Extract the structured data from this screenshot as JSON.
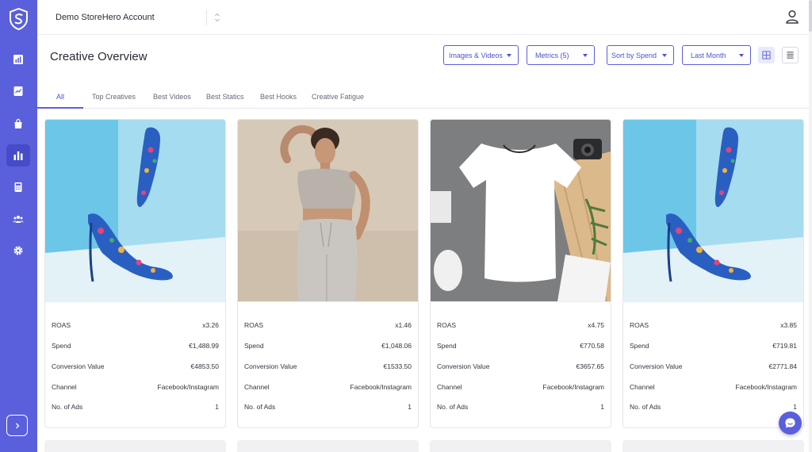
{
  "account": {
    "name": "Demo StoreHero Account"
  },
  "page": {
    "title": "Creative Overview"
  },
  "filters": {
    "media_type": "Images & Videos",
    "metrics": "Metrics (5)",
    "sort": "Sort by Spend",
    "date_range": "Last Month"
  },
  "tabs": [
    "All",
    "Top Creatives",
    "Best Videos",
    "Best Statics",
    "Best Hooks",
    "Creative Fatigue"
  ],
  "metric_labels": [
    "ROAS",
    "Spend",
    "Conversion Value",
    "Channel",
    "No. of Ads"
  ],
  "cards": [
    {
      "image": "blue-floral-heels-photo",
      "roas": "x3.26",
      "spend": "€1,488.99",
      "conversion_value": "€4853.50",
      "channel": "Facebook/Instagram",
      "ads": "1"
    },
    {
      "image": "woman-grey-crop-top-photo",
      "roas": "x1.46",
      "spend": "€1,048.06",
      "conversion_value": "€1533.50",
      "channel": "Facebook/Instagram",
      "ads": "1"
    },
    {
      "image": "white-tshirt-flatlay-photo",
      "roas": "x4.75",
      "spend": "€770.58",
      "conversion_value": "€3657.65",
      "channel": "Facebook/Instagram",
      "ads": "1"
    },
    {
      "image": "blue-floral-heels-photo",
      "roas": "x3.85",
      "spend": "€719.81",
      "conversion_value": "€2771.84",
      "channel": "Facebook/Instagram",
      "ads": "1"
    }
  ],
  "colors": {
    "brand": "#5a5fdc",
    "sidebar_active": "#464bc7"
  }
}
